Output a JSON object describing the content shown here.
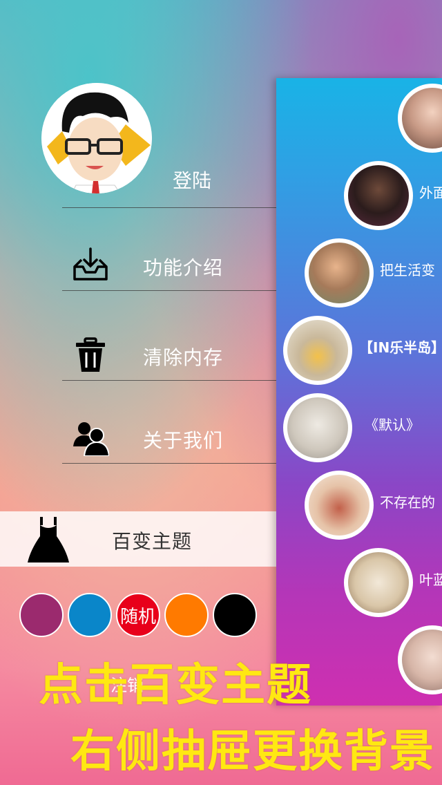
{
  "menu": {
    "login_label": "登陆",
    "items": [
      {
        "label": "功能介绍",
        "icon": "inbox-download-icon"
      },
      {
        "label": "清除内存",
        "icon": "trash-icon"
      },
      {
        "label": "关于我们",
        "icon": "users-icon"
      }
    ],
    "theme": {
      "label": "百变主题",
      "icon": "dress-icon"
    },
    "swatches": [
      {
        "color": "#9b2a6e",
        "label": ""
      },
      {
        "color": "#0a86c9",
        "label": ""
      },
      {
        "color": "#e8001a",
        "label": "随机"
      },
      {
        "color": "#ff7a00",
        "label": ""
      },
      {
        "color": "#000000",
        "label": ""
      }
    ],
    "logout_label": "注销"
  },
  "drawer": {
    "songs": [
      {
        "title": ""
      },
      {
        "title": "外面"
      },
      {
        "title": "把生活变"
      },
      {
        "title": "【IN乐半岛】"
      },
      {
        "title": "《默认》"
      },
      {
        "title": "不存在的"
      },
      {
        "title": "叶蓝"
      },
      {
        "title": ""
      }
    ]
  },
  "overlay": {
    "line1": "点击百变主题",
    "line2": "右侧抽屉更换背景"
  }
}
